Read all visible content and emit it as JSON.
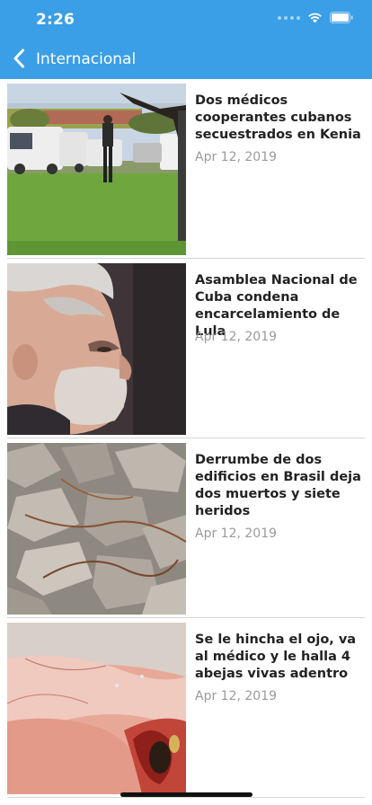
{
  "status_bar": {
    "time": "2:26"
  },
  "nav": {
    "title": "Internacional",
    "back_icon": "chevron-left-icon"
  },
  "colors": {
    "nav_background": "#3a9fe6",
    "nav_text": "#ffffff",
    "date_text": "#9a9a9a"
  },
  "articles": [
    {
      "title": "Dos médicos cooperantes cubanos secuestrados en Kenia",
      "date": "Apr 12, 2019"
    },
    {
      "title": "Asamblea Nacional de Cuba condena encarcelamiento de Lula",
      "date": "Apr 12, 2019"
    },
    {
      "title": "Derrumbe de dos edificios en Brasil deja dos muertos y siete heridos",
      "date": "Apr 12, 2019"
    },
    {
      "title": "Se le hincha el ojo, va al médico y le halla 4 abejas vivas adentro",
      "date": "Apr 12, 2019"
    }
  ]
}
